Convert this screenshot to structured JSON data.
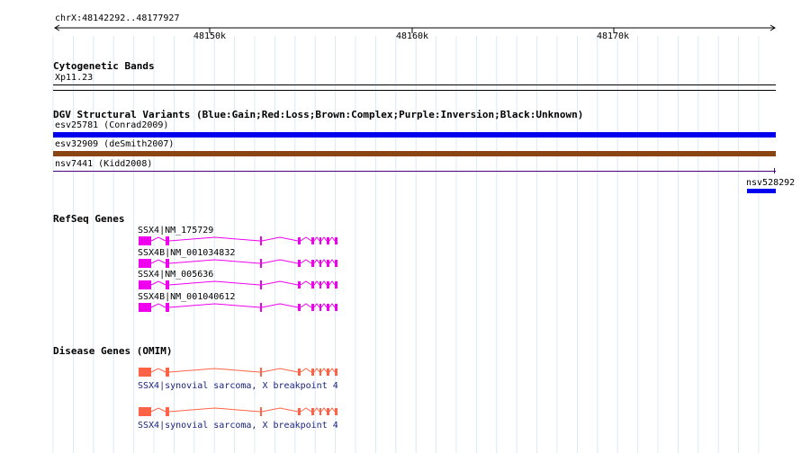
{
  "ruler": {
    "location": "chrX:48142292..48177927",
    "ticks": [
      "48150k",
      "48160k",
      "48170k"
    ]
  },
  "cytoband": {
    "title": "Cytogenetic Bands",
    "band": "Xp11.23"
  },
  "dgv": {
    "title": "DGV Structural Variants (Blue:Gain;Red:Loss;Brown:Complex;Purple:Inversion;Black:Unknown)",
    "variants": [
      {
        "label": "esv25781 (Conrad2009)",
        "color": "#0000ee"
      },
      {
        "label": "esv32909 (deSmith2007)",
        "color": "#8b4513"
      },
      {
        "label": "nsv7441 (Kidd2008)",
        "color": "#4b0082"
      },
      {
        "label": "nsv528292",
        "color": "#0000ee"
      }
    ]
  },
  "refseq": {
    "title": "RefSeq Genes",
    "color": "#ee00ee",
    "genes": [
      {
        "label": "SSX4|NM_175729"
      },
      {
        "label": "SSX4B|NM_001034832"
      },
      {
        "label": "SSX4|NM_005636"
      },
      {
        "label": "SSX4B|NM_001040612"
      }
    ]
  },
  "omim": {
    "title": "Disease Genes (OMIM)",
    "color": "#ff6347",
    "genes": [
      {
        "label": "SSX4|synovial sarcoma, X breakpoint 4"
      },
      {
        "label": "SSX4|synovial sarcoma, X breakpoint 4"
      }
    ]
  }
}
